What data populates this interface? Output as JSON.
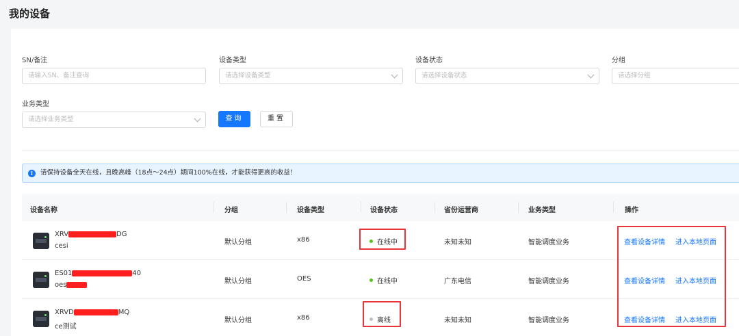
{
  "page": {
    "title": "我的设备"
  },
  "filters": {
    "sn": {
      "label": "SN/备注",
      "placeholder": "请输入SN、备注查询"
    },
    "device_type": {
      "label": "设备类型",
      "placeholder": "请选择设备类型"
    },
    "device_status": {
      "label": "设备状态",
      "placeholder": "请选择设备状态"
    },
    "group": {
      "label": "分组",
      "placeholder": "请选择分组"
    },
    "business_type": {
      "label": "业务类型",
      "placeholder": "请选择业务类型"
    },
    "query_label": "查询",
    "reset_label": "重置"
  },
  "alert": {
    "text": "请保持设备全天在线，且晚高峰（18点～24点）期间100%在线，才能获得更高的收益！"
  },
  "table": {
    "headers": [
      "设备名称",
      "分组",
      "设备类型",
      "设备状态",
      "省份运营商",
      "业务类型",
      "操作"
    ],
    "rows": [
      {
        "sn_prefix": "XRV",
        "sn_suffix": "DG",
        "note": "cesi",
        "group": "默认分组",
        "type": "x86",
        "status": "在线中",
        "isp": "未知未知",
        "business": "智能调度业务",
        "action1": "查看设备详情",
        "action2": "进入本地页面"
      },
      {
        "sn_prefix": "ES01",
        "sn_suffix": "40",
        "note": "oes",
        "group": "默认分组",
        "type": "OES",
        "status": "在线中",
        "isp": "广东电信",
        "business": "智能调度业务",
        "action1": "查看设备详情",
        "action2": "进入本地页面"
      },
      {
        "sn_prefix": "XRVD",
        "sn_suffix": "MQ",
        "note": "ce测试",
        "group": "默认分组",
        "type": "x86",
        "status": "离线",
        "isp": "未知未知",
        "business": "智能调度业务",
        "action1": "查看设备详情",
        "action2": "进入本地页面"
      }
    ]
  },
  "colors": {
    "primary": "#1677ff",
    "online": "#52c41a",
    "offline": "#bfbfbf",
    "annotation": "#e8333a",
    "redaction": "#ff1f1f"
  }
}
